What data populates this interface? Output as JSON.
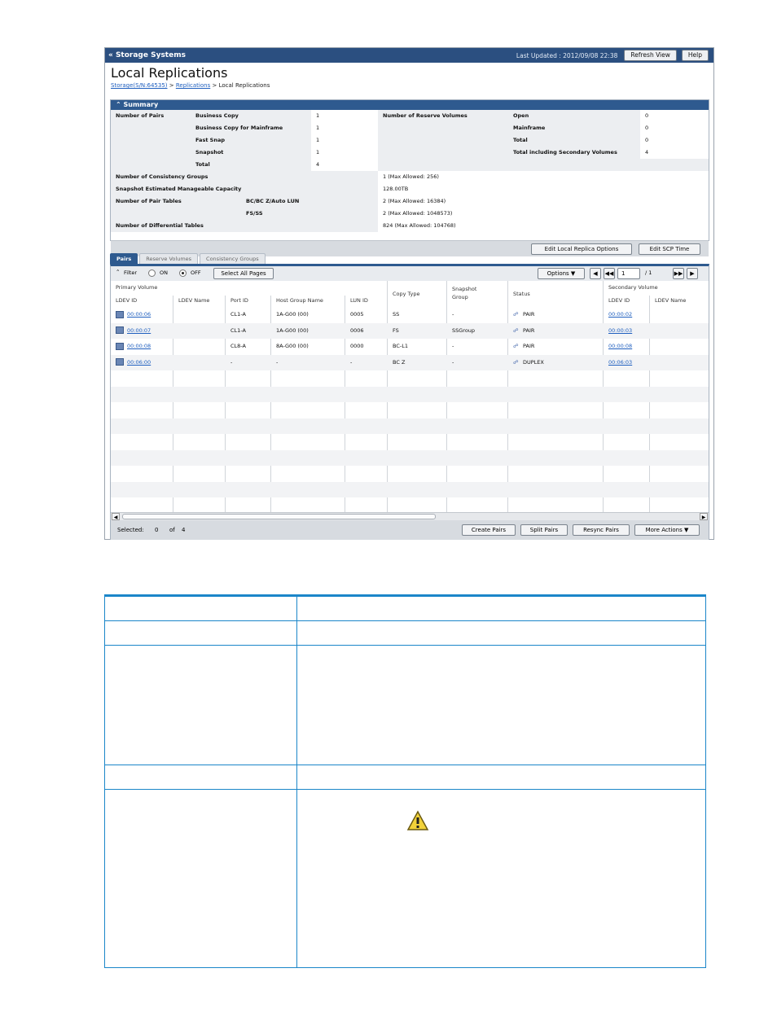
{
  "header": {
    "nav_label": "« Storage Systems",
    "last_updated": "Last Updated : 2012/09/08 22:38",
    "refresh_label": "Refresh View",
    "help_label": "Help"
  },
  "page": {
    "title": "Local Replications",
    "breadcrumb": [
      "Storage(S/N:64535)",
      "Replications",
      "Local Replications"
    ],
    "breadcrumb_sep": ">"
  },
  "summary": {
    "title": "Summary",
    "pairs_label": "Number of Pairs",
    "pairs": [
      {
        "label": "Business Copy",
        "value": "1"
      },
      {
        "label": "Business Copy for Mainframe",
        "value": "1"
      },
      {
        "label": "Fast Snap",
        "value": "1"
      },
      {
        "label": "Snapshot",
        "value": "1"
      },
      {
        "label": "Total",
        "value": "4"
      }
    ],
    "reserve_label": "Number of Reserve Volumes",
    "reserve": [
      {
        "label": "Open",
        "value": "0"
      },
      {
        "label": "Mainframe",
        "value": "0"
      },
      {
        "label": "Total",
        "value": "0"
      },
      {
        "label": "Total including Secondary Volumes",
        "value": "4"
      }
    ],
    "consistency_label": "Number of Consistency Groups",
    "consistency_value": "1 (Max Allowed: 256)",
    "snapshot_cap_label": "Snapshot Estimated Manageable Capacity",
    "snapshot_cap_value": "128.00TB",
    "pair_tables_label": "Number of Pair Tables",
    "pair_tables": [
      {
        "label": "BC/BC Z/Auto LUN",
        "value": "2 (Max Allowed: 16384)"
      },
      {
        "label": "FS/SS",
        "value": "2 (Max Allowed: 1048573)"
      }
    ],
    "diff_label": "Number of Differential Tables",
    "diff_value": "824 (Max Allowed: 104768)",
    "edit_options_label": "Edit Local Replica Options",
    "edit_scp_label": "Edit SCP Time"
  },
  "tabs": [
    "Pairs",
    "Reserve Volumes",
    "Consistency Groups"
  ],
  "filter": {
    "label": "Filter",
    "on": "ON",
    "off": "OFF",
    "select_all": "Select All Pages",
    "options": "Options",
    "page": "1",
    "of_pages": "/ 1"
  },
  "table": {
    "group_primary": "Primary Volume",
    "group_secondary": "Secondary Volume",
    "columns": [
      "LDEV ID",
      "LDEV Name",
      "Port ID",
      "Host Group Name",
      "LUN ID",
      "Copy Type",
      "Snapshot Group",
      "Status",
      "LDEV ID",
      "LDEV Name"
    ],
    "rows": [
      {
        "ldev": "00:00:06",
        "name": "",
        "port": "CL1-A",
        "hg": "1A-G00 (00)",
        "lun": "0005",
        "copy": "SS",
        "snap": "-",
        "status": "PAIR",
        "sldev": "00:00:02",
        "sname": ""
      },
      {
        "ldev": "00:00:07",
        "name": "",
        "port": "CL1-A",
        "hg": "1A-G00 (00)",
        "lun": "0006",
        "copy": "FS",
        "snap": "SSGroup",
        "status": "PAIR",
        "sldev": "00:00:03",
        "sname": ""
      },
      {
        "ldev": "00:00:08",
        "name": "",
        "port": "CL8-A",
        "hg": "8A-G00 (00)",
        "lun": "0000",
        "copy": "BC-L1",
        "snap": "-",
        "status": "PAIR",
        "sldev": "00:00:08",
        "sname": ""
      },
      {
        "ldev": "00:06:00",
        "name": "",
        "port": "-",
        "hg": "-",
        "lun": "-",
        "copy": "BC Z",
        "snap": "-",
        "status": "DUPLEX",
        "sldev": "00:06:03",
        "sname": ""
      }
    ]
  },
  "footer": {
    "selected": "Selected:",
    "selected_count": "0",
    "of": "of",
    "total": "4",
    "create": "Create Pairs",
    "split": "Split Pairs",
    "resync": "Resync Pairs",
    "more": "More Actions"
  },
  "colors": {
    "header": "#2b4f80",
    "accent": "#2e5a8f",
    "doc_rule": "#1b86c9"
  }
}
